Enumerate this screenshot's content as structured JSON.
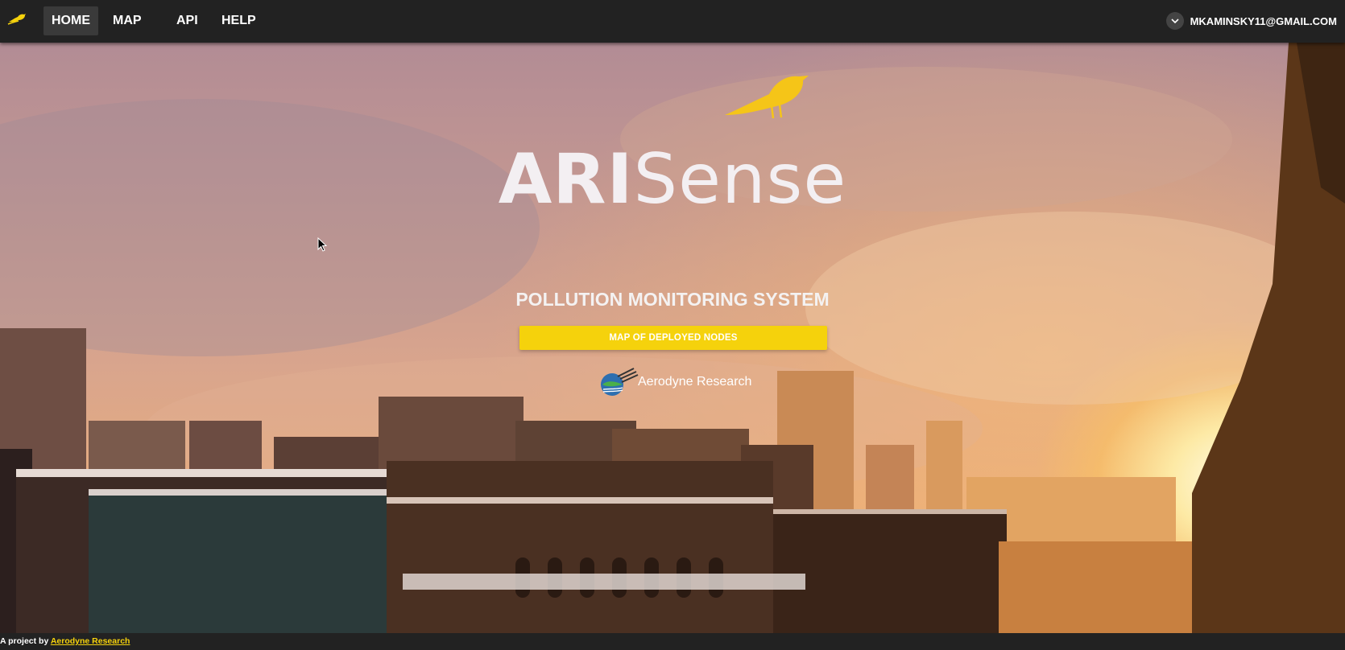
{
  "nav": {
    "items": [
      {
        "label": "HOME",
        "active": true
      },
      {
        "label": "MAP",
        "active": false
      },
      {
        "label": "API",
        "active": false
      },
      {
        "label": "HELP",
        "active": false
      }
    ],
    "user_email": "MKAMINSKY11@GMAIL.COM",
    "logo_icon": "bird-logo-icon",
    "user_menu_icon": "chevron-down-icon"
  },
  "hero": {
    "title_bold": "ARI",
    "title_light": "Sense",
    "tagline": "POLLUTION MONITORING SYSTEM",
    "button_label": "MAP OF DEPLOYED NODES",
    "partner_label": "Aerodyne Research"
  },
  "footer": {
    "prefix": "A project by ",
    "link_label": "Aerodyne Research"
  },
  "colors": {
    "accent": "#f5d20c",
    "navbar_bg": "#222222",
    "text": "#ffffff"
  }
}
